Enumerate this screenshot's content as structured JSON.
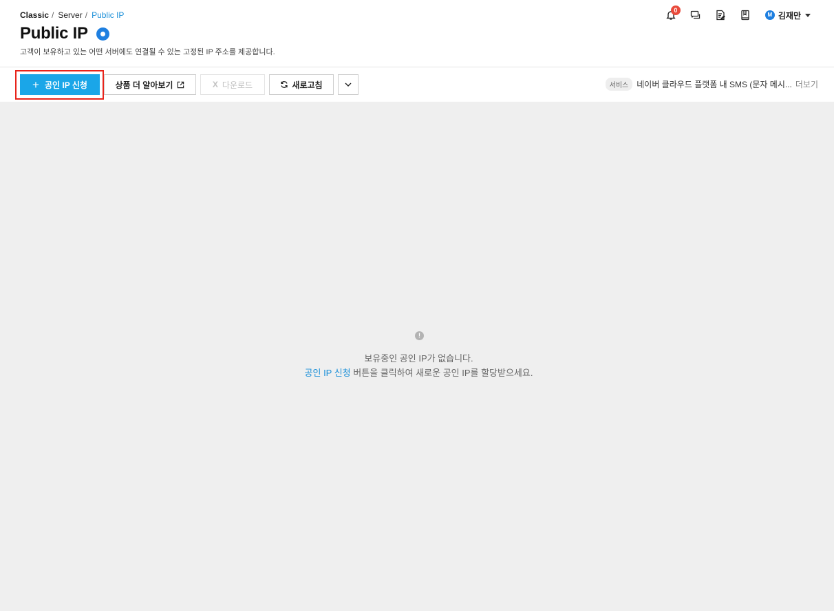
{
  "breadcrumb": {
    "items": [
      "Classic",
      "Server",
      "Public IP"
    ],
    "separator": "/"
  },
  "page": {
    "title": "Public IP",
    "subtitle": "고객이 보유하고 있는 어떤 서버에도 연결될 수 있는 고정된 IP 주소를 제공합니다."
  },
  "header": {
    "notification_count": "0",
    "icons": [
      "bell-icon",
      "chat-icon",
      "memo-icon",
      "guide-book-icon"
    ],
    "user": {
      "avatar_letter": "M",
      "name": "김재만"
    }
  },
  "toolbar": {
    "apply_label": "공인 IP 신청",
    "learn_more_label": "상품 더 알아보기",
    "download_label": "다운로드",
    "download_prefix": "X",
    "refresh_label": "새로고침"
  },
  "notice": {
    "tag": "서비스",
    "text": "네이버 클라우드 플랫폼 내 SMS (문자 메시...",
    "more_label": "더보기"
  },
  "empty_state": {
    "icon_glyph": "!",
    "message": "보유중인 공인 IP가 없습니다.",
    "link_text": "공인 IP 신청",
    "hint": " 버튼을 클릭하여 새로운 공인 IP를 할당받으세요."
  },
  "colors": {
    "primary": "#1aa6e8",
    "link": "#1a8fd8",
    "badge": "#e94b3c",
    "highlight": "#e8231a",
    "content_bg": "#efefef"
  }
}
